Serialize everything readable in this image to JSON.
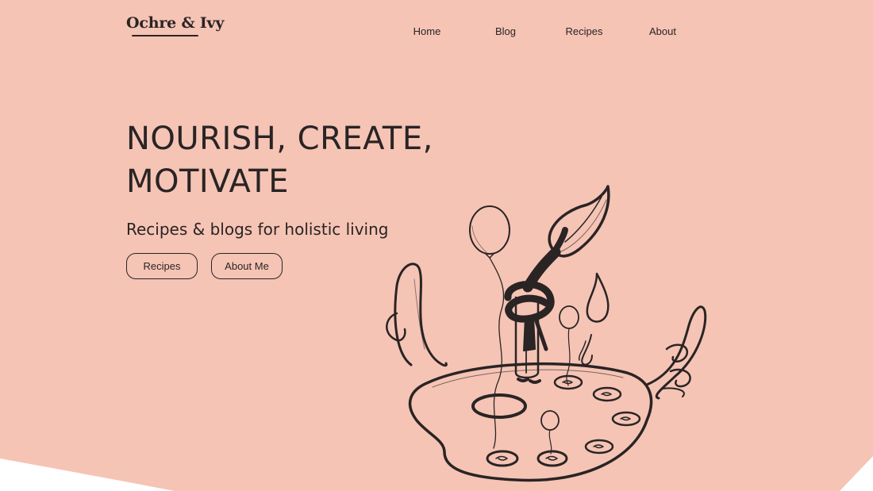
{
  "brand": {
    "name": "Ochre & Ivy"
  },
  "nav": {
    "items": [
      {
        "label": "Home"
      },
      {
        "label": "Blog"
      },
      {
        "label": "Recipes"
      },
      {
        "label": "About"
      }
    ]
  },
  "hero": {
    "headline": "NOURISH, CREATE, MOTIVATE",
    "subheadline": "Recipes & blogs for holistic living",
    "buttons": {
      "recipes_label": "Recipes",
      "about_label": "About Me"
    }
  },
  "colors": {
    "hero_background": "#f5c4b5",
    "page_background": "#ffffff",
    "ink": "#2a2424"
  },
  "illustration": {
    "icon": "paint-palette-character-icon"
  }
}
